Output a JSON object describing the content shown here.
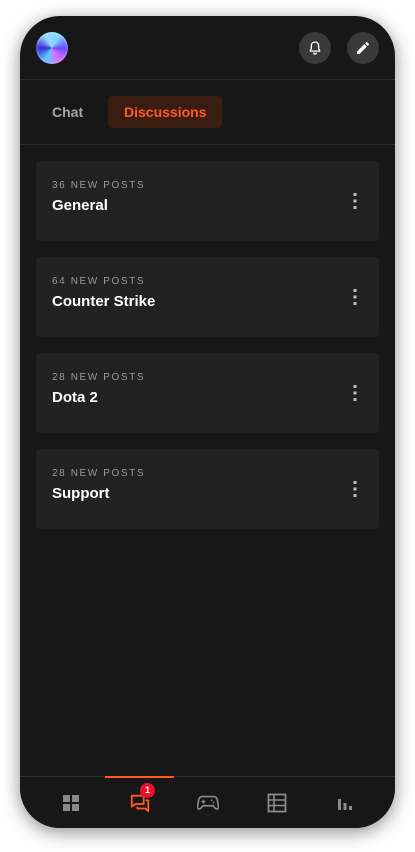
{
  "header": {
    "avatar_icon": "user-avatar",
    "notifications_icon": "bell-icon",
    "compose_icon": "pencil-icon"
  },
  "tabs": [
    {
      "label": "Chat",
      "active": false
    },
    {
      "label": "Discussions",
      "active": true
    }
  ],
  "discussions": [
    {
      "meta": "36 NEW POSTS",
      "title": "General"
    },
    {
      "meta": "64 NEW POSTS",
      "title": "Counter Strike"
    },
    {
      "meta": "28 NEW POSTS",
      "title": "Dota 2"
    },
    {
      "meta": "28 NEW POSTS",
      "title": "Support"
    }
  ],
  "bottom_nav": {
    "items": [
      {
        "icon": "grid-icon",
        "active": false
      },
      {
        "icon": "chat-icon",
        "active": true,
        "badge": "1"
      },
      {
        "icon": "gamepad-icon",
        "active": false
      },
      {
        "icon": "table-icon",
        "active": false
      },
      {
        "icon": "bar-chart-icon",
        "active": false
      }
    ]
  },
  "colors": {
    "background": "#171717",
    "card": "#222222",
    "accent": "#ff5a1f",
    "badge": "#e8122d"
  }
}
